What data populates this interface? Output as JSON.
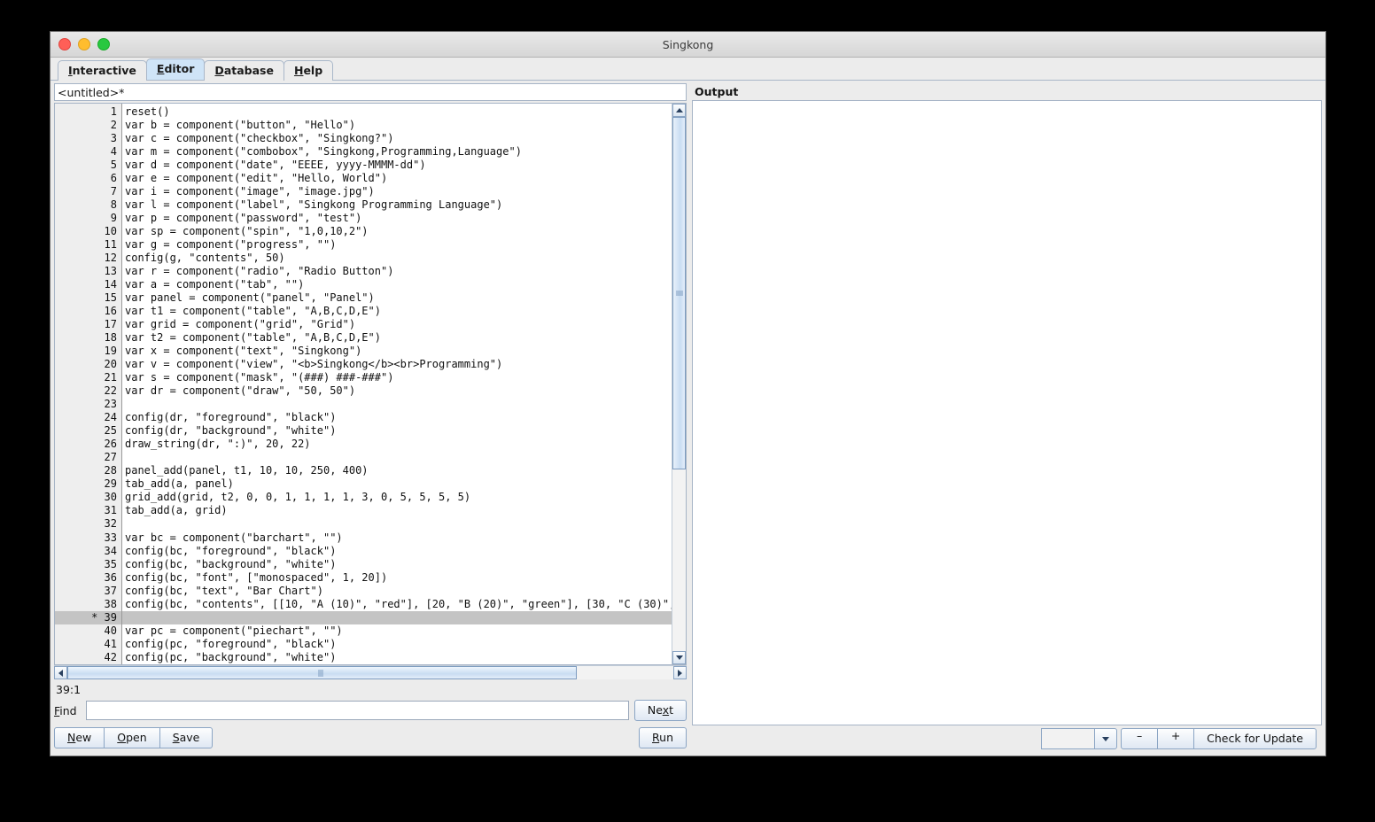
{
  "window": {
    "title": "Singkong",
    "controls": [
      "close",
      "minimize",
      "zoom"
    ]
  },
  "tabs": [
    {
      "label": "Interactive",
      "mnemonic": "I",
      "selected": false
    },
    {
      "label": "Editor",
      "mnemonic": "E",
      "selected": true
    },
    {
      "label": "Database",
      "mnemonic": "D",
      "selected": false
    },
    {
      "label": "Help",
      "mnemonic": "H",
      "selected": false
    }
  ],
  "editor": {
    "filename": "<untitled>*",
    "caret_position": "39:1",
    "current_line": 39,
    "first_visible_line": 1,
    "modified_marker": "*",
    "lines": [
      "reset()",
      "var b = component(\"button\", \"Hello\")",
      "var c = component(\"checkbox\", \"Singkong?\")",
      "var m = component(\"combobox\", \"Singkong,Programming,Language\")",
      "var d = component(\"date\", \"EEEE, yyyy-MMMM-dd\")",
      "var e = component(\"edit\", \"Hello, World\")",
      "var i = component(\"image\", \"image.jpg\")",
      "var l = component(\"label\", \"Singkong Programming Language\")",
      "var p = component(\"password\", \"test\")",
      "var sp = component(\"spin\", \"1,0,10,2\")",
      "var g = component(\"progress\", \"\")",
      "config(g, \"contents\", 50)",
      "var r = component(\"radio\", \"Radio Button\")",
      "var a = component(\"tab\", \"\")",
      "var panel = component(\"panel\", \"Panel\")",
      "var t1 = component(\"table\", \"A,B,C,D,E\")",
      "var grid = component(\"grid\", \"Grid\")",
      "var t2 = component(\"table\", \"A,B,C,D,E\")",
      "var x = component(\"text\", \"Singkong\")",
      "var v = component(\"view\", \"<b>Singkong</b><br>Programming\")",
      "var s = component(\"mask\", \"(###) ###-###\")",
      "var dr = component(\"draw\", \"50, 50\")",
      "",
      "config(dr, \"foreground\", \"black\")",
      "config(dr, \"background\", \"white\")",
      "draw_string(dr, \":)\", 20, 22)",
      "",
      "panel_add(panel, t1, 10, 10, 250, 400)",
      "tab_add(a, panel)",
      "grid_add(grid, t2, 0, 0, 1, 1, 1, 1, 3, 0, 5, 5, 5, 5)",
      "tab_add(a, grid)",
      "",
      "var bc = component(\"barchart\", \"\")",
      "config(bc, \"foreground\", \"black\")",
      "config(bc, \"background\", \"white\")",
      "config(bc, \"font\", [\"monospaced\", 1, 20])",
      "config(bc, \"text\", \"Bar Chart\")",
      "config(bc, \"contents\", [[10, \"A (10)\", \"red\"], [20, \"B (20)\", \"green\"], [30, \"C (30)\", \"",
      "",
      "var pc = component(\"piechart\", \"\")",
      "config(pc, \"foreground\", \"black\")",
      "config(pc, \"background\", \"white\")"
    ]
  },
  "find": {
    "label": "Find",
    "mnemonic": "F",
    "value": "",
    "placeholder": "",
    "next_label": "Next",
    "next_mnemonic": "x"
  },
  "file_buttons": [
    {
      "label": "New",
      "mnemonic": "N"
    },
    {
      "label": "Open",
      "mnemonic": "O"
    },
    {
      "label": "Save",
      "mnemonic": "S"
    }
  ],
  "run_button": {
    "label": "Run",
    "mnemonic": "R"
  },
  "output": {
    "label": "Output",
    "content": ""
  },
  "statusbar": {
    "combo_value": "",
    "minus_label": "–",
    "plus_label": "+",
    "update_label": "Check for Update"
  }
}
